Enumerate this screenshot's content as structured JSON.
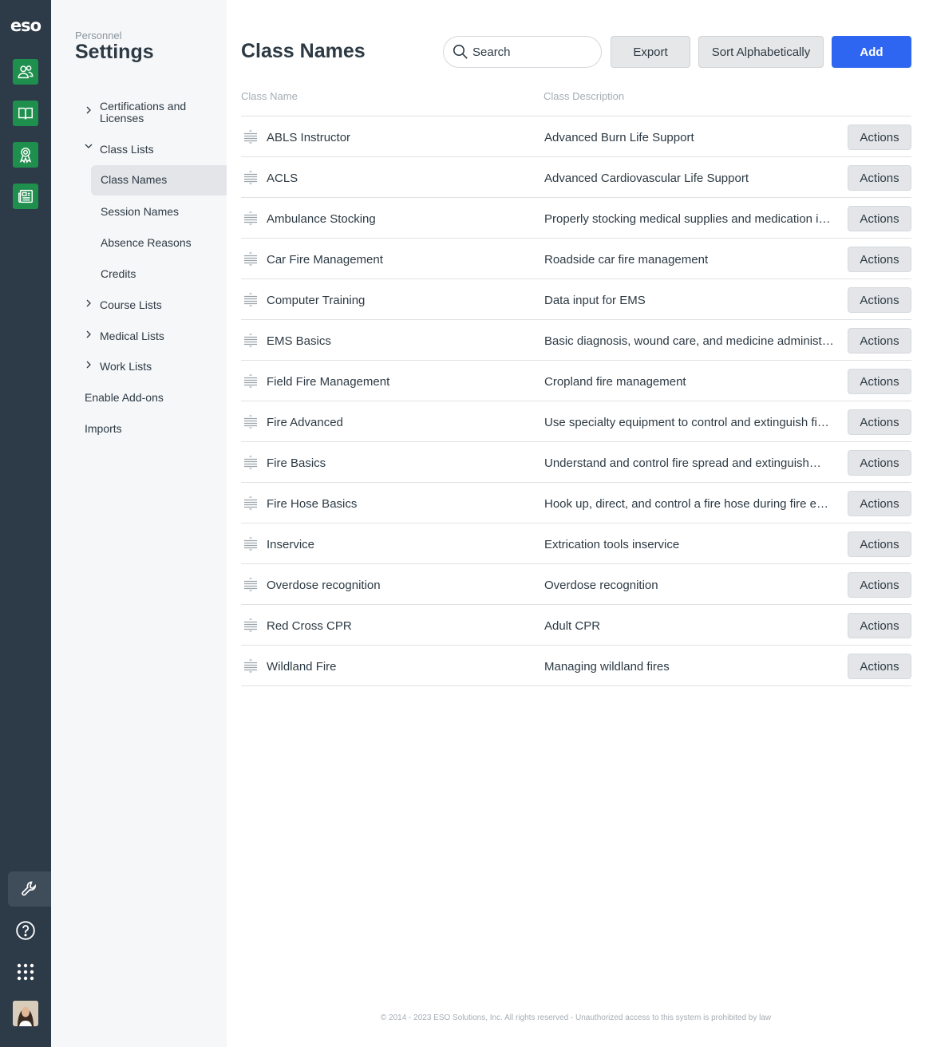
{
  "rail": {
    "logo": "eso",
    "apps": [
      {
        "icon": "people-icon"
      },
      {
        "icon": "book-icon"
      },
      {
        "icon": "award-icon"
      },
      {
        "icon": "news-icon"
      }
    ],
    "bottom": [
      {
        "icon": "wrench-icon"
      },
      {
        "icon": "help-icon"
      },
      {
        "icon": "app-grid-icon"
      }
    ],
    "accent_color": "#1f8f4e",
    "background_color": "#2d3a48"
  },
  "subnav": {
    "context": "Personnel",
    "title": "Settings",
    "items": [
      {
        "label": "Certifications and Licenses"
      },
      {
        "label": "Class Lists"
      },
      {
        "label": "Class Names"
      },
      {
        "label": "Session Names"
      },
      {
        "label": "Absence Reasons"
      },
      {
        "label": "Credits"
      },
      {
        "label": "Course Lists"
      },
      {
        "label": "Medical Lists"
      },
      {
        "label": "Work Lists"
      },
      {
        "label": "Enable Add-ons"
      },
      {
        "label": "Imports"
      }
    ]
  },
  "main": {
    "title": "Class Names",
    "search": {
      "placeholder": "Search"
    },
    "buttons": {
      "export": "Export",
      "sort": "Sort Alphabetically",
      "add": "Add"
    },
    "primary_color": "#2f66f1",
    "columns": {
      "name": "Class Name",
      "description": "Class Description"
    },
    "rows": [
      {
        "name": "ABLS Instructor",
        "description": "Advanced Burn Life Support",
        "action": "Actions"
      },
      {
        "name": "ACLS",
        "description": "Advanced Cardiovascular Life Support",
        "action": "Actions"
      },
      {
        "name": "Ambulance Stocking",
        "description": "Properly stocking medical supplies and medication i…",
        "action": "Actions"
      },
      {
        "name": "Car Fire Management",
        "description": "Roadside car fire management",
        "action": "Actions"
      },
      {
        "name": "Computer Training",
        "description": "Data input for EMS",
        "action": "Actions"
      },
      {
        "name": "EMS Basics",
        "description": "Basic diagnosis, wound care, and medicine administ…",
        "action": "Actions"
      },
      {
        "name": "Field Fire Management",
        "description": "Cropland fire management",
        "action": "Actions"
      },
      {
        "name": "Fire Advanced",
        "description": "Use specialty equipment to control and extinguish fi…",
        "action": "Actions"
      },
      {
        "name": "Fire Basics",
        "description": "Understand and control fire spread and extinguish…",
        "action": "Actions"
      },
      {
        "name": "Fire Hose Basics",
        "description": "Hook up, direct, and control a fire hose during fire e…",
        "action": "Actions"
      },
      {
        "name": "Inservice",
        "description": "Extrication tools inservice",
        "action": "Actions"
      },
      {
        "name": "Overdose recognition",
        "description": "Overdose recognition",
        "action": "Actions"
      },
      {
        "name": "Red Cross CPR",
        "description": "Adult CPR",
        "action": "Actions"
      },
      {
        "name": "Wildland Fire",
        "description": "Managing wildland fires",
        "action": "Actions"
      }
    ],
    "footer": "© 2014 - 2023 ESO Solutions, Inc. All rights reserved - Unauthorized access to this system is prohibited by law"
  }
}
